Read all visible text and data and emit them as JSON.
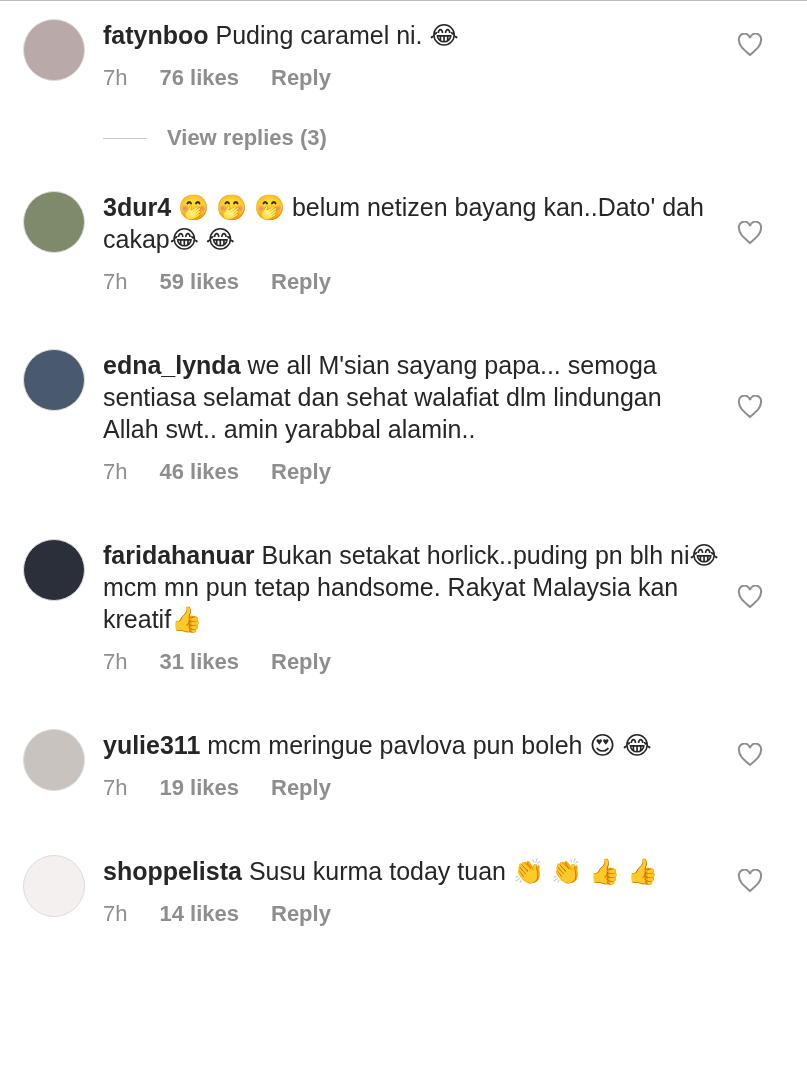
{
  "comments": [
    {
      "username": "fatynboo",
      "text": "Puding caramel ni. 😂",
      "time": "7h",
      "likes": "76 likes",
      "reply": "Reply",
      "liked": false,
      "view_replies": "View replies (3)"
    },
    {
      "username": "3dur4",
      "text": "🤭 🤭 🤭  belum netizen bayang kan..Dato' dah cakap😂 😂",
      "time": "7h",
      "likes": "59 likes",
      "reply": "Reply",
      "liked": false
    },
    {
      "username": "edna_lynda",
      "text": "we all M'sian sayang papa... semoga sentiasa selamat dan sehat walafiat dlm lindungan Allah swt.. amin yarabbal alamin..",
      "time": "7h",
      "likes": "46 likes",
      "reply": "Reply",
      "liked": false
    },
    {
      "username": "faridahanuar",
      "text": "Bukan setakat horlick..puding pn blh ni😂  mcm mn pun tetap handsome. Rakyat Malaysia kan kreatif👍",
      "time": "7h",
      "likes": "31 likes",
      "reply": "Reply",
      "liked": false
    },
    {
      "username": "yulie311",
      "text": "mcm meringue pavlova pun boleh 😍 😂",
      "time": "7h",
      "likes": "19 likes",
      "reply": "Reply",
      "liked": false
    },
    {
      "username": "shoppelista",
      "text": "Susu kurma today tuan 👏 👏 👍 👍",
      "time": "7h",
      "likes": "14 likes",
      "reply": "Reply",
      "liked": false
    }
  ]
}
